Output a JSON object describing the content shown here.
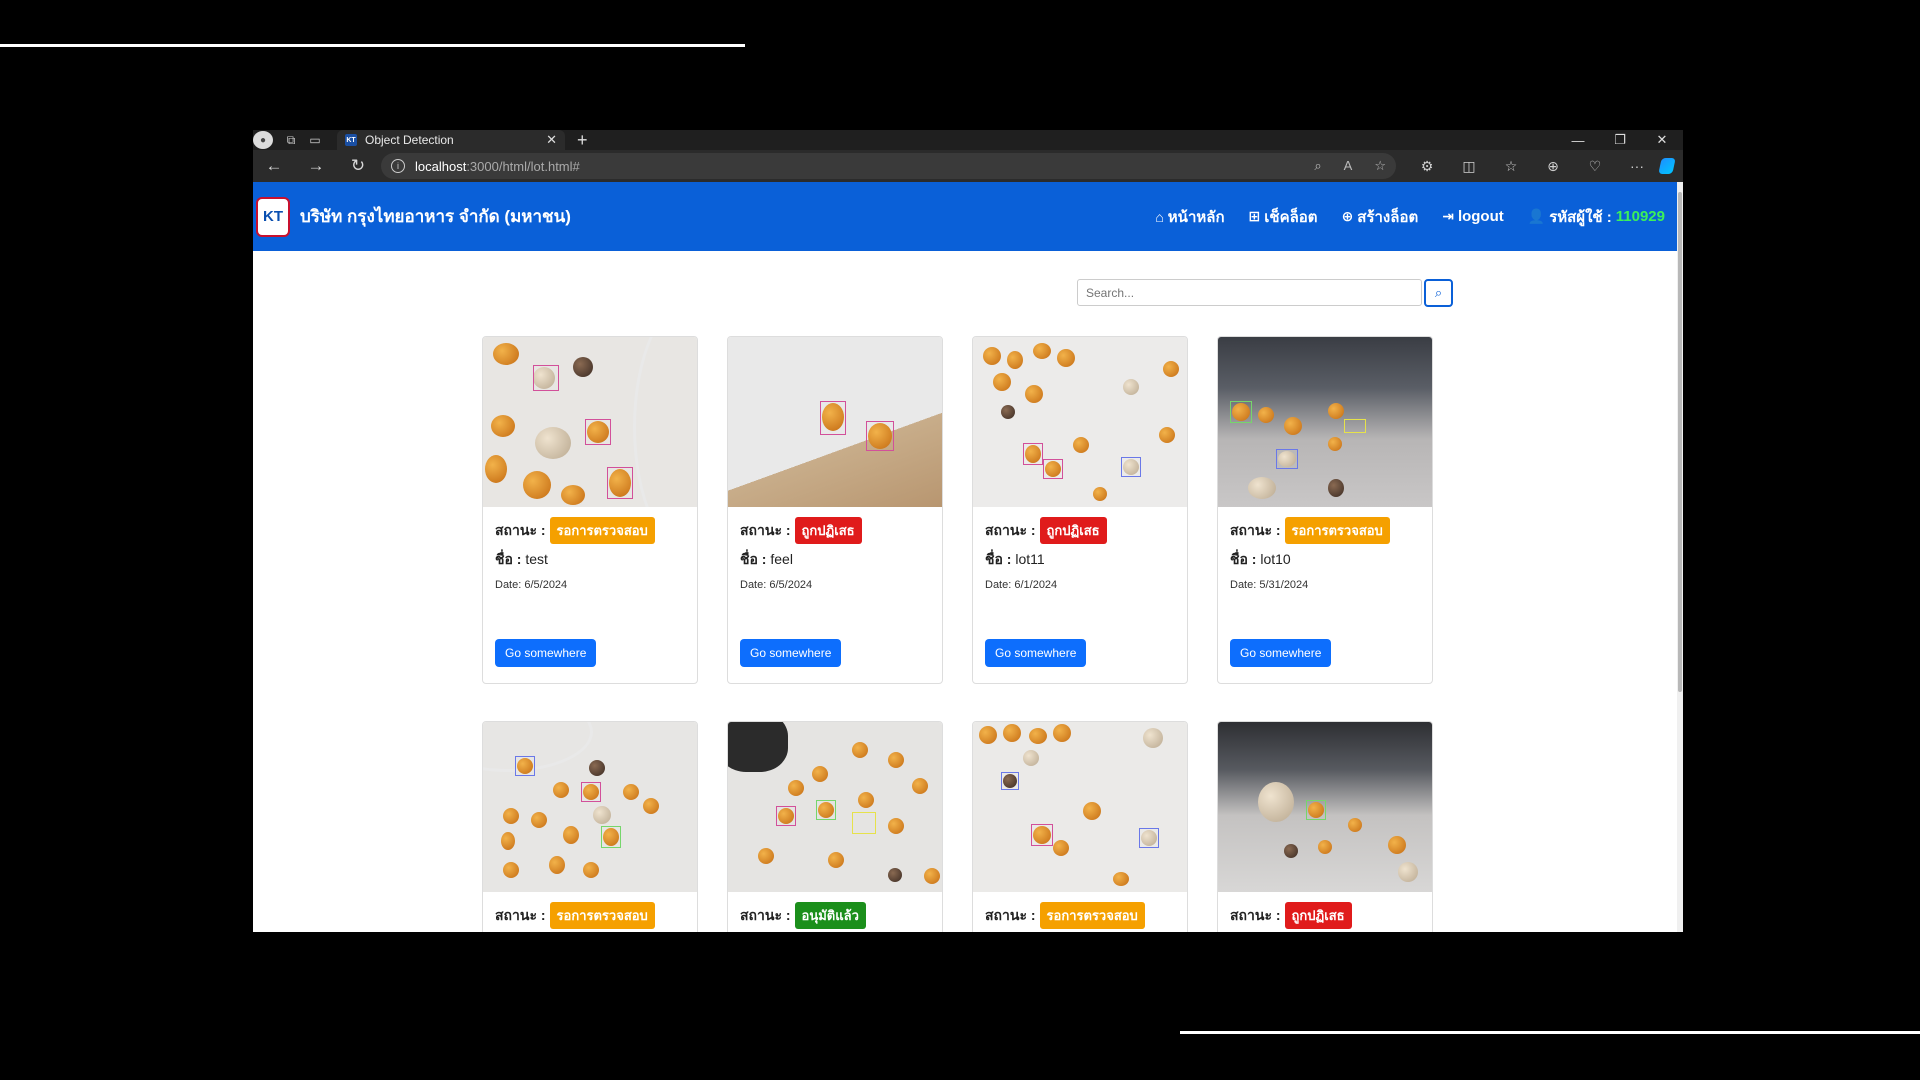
{
  "browser": {
    "tab_title": "Object Detection",
    "url_host": "localhost",
    "url_path": ":3000/html/lot.html#"
  },
  "navbar": {
    "brand": "บริษัท กรุงไทยอาหาร จำกัด (มหาชน)",
    "logo_text": "KT",
    "links": {
      "home": "หน้าหลัก",
      "check_lot": "เช็คล็อต",
      "create_lot": "สร้างล็อต",
      "logout": "logout",
      "user_label": "รหัสผู้ใช้ :",
      "user_code": "110929"
    }
  },
  "search": {
    "placeholder": "Search..."
  },
  "labels": {
    "status": "สถานะ :",
    "name": "ชื่อ :",
    "button": "Go somewhere"
  },
  "cards": [
    {
      "status": "รอการตรวจสอบ",
      "status_type": "pending",
      "name": "test",
      "date": "Date: 6/5/2024"
    },
    {
      "status": "ถูกปฏิเสธ",
      "status_type": "rejected",
      "name": "feel",
      "date": "Date: 6/5/2024"
    },
    {
      "status": "ถูกปฏิเสธ",
      "status_type": "rejected",
      "name": "lot11",
      "date": "Date: 6/1/2024"
    },
    {
      "status": "รอการตรวจสอบ",
      "status_type": "pending",
      "name": "lot10",
      "date": "Date: 5/31/2024"
    },
    {
      "status": "รอการตรวจสอบ",
      "status_type": "pending"
    },
    {
      "status": "อนุมัติแล้ว",
      "status_type": "approved"
    },
    {
      "status": "รอการตรวจสอบ",
      "status_type": "pending"
    },
    {
      "status": "ถูกปฏิเสธ",
      "status_type": "rejected"
    }
  ],
  "colors": {
    "navbar": "#0a60d8",
    "pending": "#f5a000",
    "rejected": "#e01b1b",
    "approved": "#1b8f1b",
    "primary_button": "#0d6efd"
  }
}
